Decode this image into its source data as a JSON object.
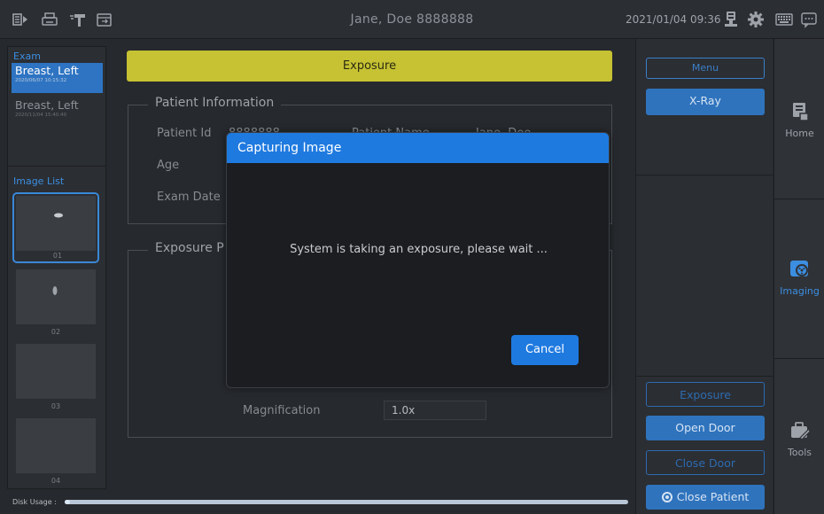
{
  "topbar": {
    "patient_title": "Jane, Doe  8888888",
    "datetime": "2021/01/04 09:36",
    "icons": [
      "worklist-icon",
      "print-icon",
      "tools-hammer-icon",
      "export-icon",
      "person-badge-icon",
      "gear-icon",
      "keyboard-icon",
      "chat-icon"
    ]
  },
  "left_panel": {
    "exam_label": "Exam",
    "exams": [
      {
        "title": "Breast, Left",
        "date": "2020/06/07 10:15:32",
        "selected": true
      },
      {
        "title": "Breast, Left",
        "date": "2020/11/04 15:40:40",
        "selected": false
      }
    ],
    "image_list_label": "Image List",
    "images": [
      "01",
      "02",
      "03",
      "04"
    ]
  },
  "center": {
    "banner": "Exposure",
    "patient_info_title": "Patient Information",
    "patient_id_label": "Patient Id",
    "patient_id_value": "8888888",
    "patient_name_label": "Patient Name",
    "patient_name_value": "Jane, Doe",
    "age_label": "Age",
    "exam_date_label": "Exam Date",
    "exposure_title": "Exposure P",
    "magnification_label": "Magnification",
    "magnification_value": "1.0x",
    "disk_label": "Disk Usage :",
    "disk_usage_fraction": 0.01
  },
  "right_panel": {
    "menu": "Menu",
    "xray": "X-Ray",
    "exposure": "Exposure",
    "open_door": "Open Door",
    "close_door": "Close Door",
    "close_patient": "Close Patient"
  },
  "nav": {
    "home": "Home",
    "imaging": "Imaging",
    "tools": "Tools"
  },
  "dialog": {
    "title": "Capturing Image",
    "message": "System is taking an exposure, please wait ...",
    "cancel": "Cancel"
  },
  "colors": {
    "accent_blue": "#1f7ae0",
    "banner_yellow": "#c6c233",
    "background": "#26292d"
  }
}
